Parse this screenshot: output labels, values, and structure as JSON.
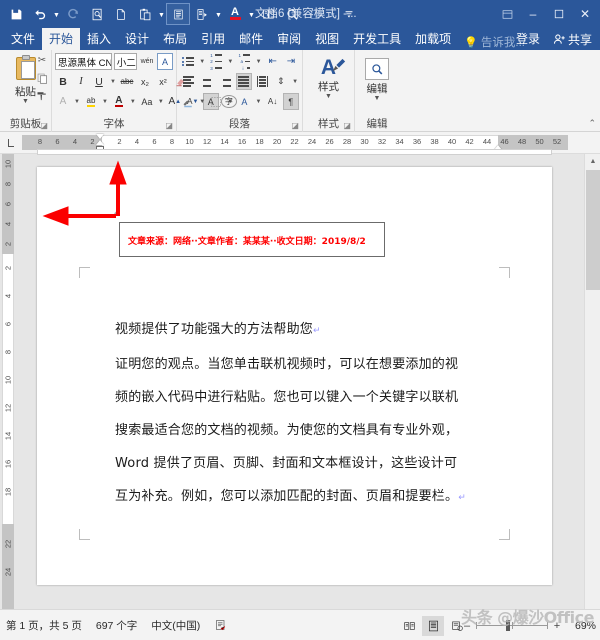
{
  "titlebar": {
    "document_title": "文档6 [兼容模式] -...",
    "quick_access": [
      {
        "name": "save-icon",
        "glyph": "Ὃe"
      },
      {
        "name": "undo-icon",
        "glyph": "↶"
      },
      {
        "name": "redo-icon",
        "glyph": "↻"
      },
      {
        "name": "print-preview-icon",
        "glyph": "ὐd"
      },
      {
        "name": "new-document-icon",
        "glyph": "὜b"
      },
      {
        "name": "paste-icon",
        "glyph": "Ὄb"
      },
      {
        "name": "document-view-icon",
        "glyph": "☰"
      },
      {
        "name": "paragraph-mark-icon",
        "glyph": "¶"
      },
      {
        "name": "font-color-icon",
        "glyph": "A"
      },
      {
        "name": "two-page-icon",
        "glyph": "Ὅ6"
      },
      {
        "name": "find-icon",
        "glyph": "ὐe"
      },
      {
        "name": "edit-icon",
        "glyph": "✎"
      },
      {
        "name": "customize-qat-icon",
        "glyph": "≡"
      }
    ],
    "window_controls": {
      "ribbon_display": "⬚",
      "minimize": "–",
      "maximize": "□",
      "close": "✕"
    }
  },
  "tabs": [
    {
      "label": "文件",
      "active": false,
      "style": "file"
    },
    {
      "label": "开始",
      "active": true,
      "style": "normal"
    },
    {
      "label": "插入",
      "active": false,
      "style": "normal"
    },
    {
      "label": "设计",
      "active": false,
      "style": "normal"
    },
    {
      "label": "布局",
      "active": false,
      "style": "normal"
    },
    {
      "label": "引用",
      "active": false,
      "style": "normal"
    },
    {
      "label": "邮件",
      "active": false,
      "style": "normal"
    },
    {
      "label": "审阅",
      "active": false,
      "style": "normal"
    },
    {
      "label": "视图",
      "active": false,
      "style": "normal"
    },
    {
      "label": "开发工具",
      "active": false,
      "style": "normal"
    },
    {
      "label": "加载项",
      "active": false,
      "style": "normal"
    }
  ],
  "tellme": {
    "placeholder": "告诉我..."
  },
  "account": {
    "signin_label": "登录",
    "share_label": "共享"
  },
  "ribbon": {
    "clipboard": {
      "group_title": "剪贴板",
      "paste_label": "粘贴",
      "cut_title": "剪切",
      "copy_title": "复制",
      "format_painter_title": "格式刷"
    },
    "font": {
      "group_title": "字体",
      "font_name": "思源黑体 CN Light (中文",
      "font_size": "小二",
      "bold": "B",
      "italic": "I",
      "underline": "U",
      "strikethrough": "abc",
      "subscript": "x₂",
      "superscript": "x²",
      "clear_format": "⌫",
      "text_effects": "A",
      "highlight": "ab",
      "font_color": "A",
      "change_case": "Aa",
      "grow_font": "A",
      "shrink_font": "A",
      "char_shading": "A",
      "char_border": "字",
      "phonetic_guide": "wén"
    },
    "paragraph": {
      "group_title": "段落",
      "bullets": "bullet-list",
      "numbering": "numbered-list",
      "multilevel": "multilevel-list",
      "decrease_indent": "decrease-indent",
      "increase_indent": "increase-indent",
      "align_left": "align-left",
      "align_center": "align-center",
      "align_right": "align-right",
      "justify": "justify",
      "distribute": "distribute",
      "line_spacing": "line-spacing",
      "shading": "shading",
      "borders": "borders",
      "pinyin": "pinyin",
      "sort": "sort",
      "show_marks": "show-paragraph-marks"
    },
    "styles": {
      "group_title": "样式",
      "label": "样式"
    },
    "editing": {
      "group_title": "编辑",
      "label": "编辑"
    }
  },
  "ruler": {
    "tab_selector": "left-tab",
    "horizontal_left_numbers": [
      "8",
      "6",
      "4",
      "2"
    ],
    "horizontal_numbers": [
      "2",
      "4",
      "6",
      "8",
      "10",
      "12",
      "14",
      "16",
      "18",
      "20",
      "22",
      "24",
      "26",
      "28",
      "30",
      "32",
      "34",
      "36",
      "38",
      "40",
      "42",
      "44",
      "46",
      "48",
      "50",
      "52"
    ],
    "vertical_top_numbers": [
      "10",
      "8",
      "6",
      "4",
      "2"
    ],
    "vertical_numbers": [
      "2",
      "4",
      "6",
      "8",
      "10",
      "12",
      "14",
      "16",
      "18"
    ],
    "vertical_bottom_numbers": [
      "22",
      "24"
    ]
  },
  "document": {
    "textbox_text": "文章来源：网络··文章作者：某某某··收文日期：2019/8/2",
    "textbox_color": "#ff0000",
    "body_lines": [
      "视频提供了功能强大的方法帮助您",
      "证明您的观点。当您单击联机视频时，可以在想要添加的视",
      "频的嵌入代码中进行粘贴。您也可以键入一个关键字以联机",
      "搜索最适合您的文档的视频。为使您的文档具有专业外观，",
      "Word 提供了页眉、页脚、封面和文本框设计，这些设计可",
      "互为补充。例如，您可以添加匹配的封面、页眉和提要栏。"
    ],
    "annotation": {
      "arrow_color": "#ff0000",
      "arrows": [
        "up-arrow",
        "left-arrow"
      ]
    }
  },
  "statusbar": {
    "page_info": "第 1 页，共 5 页",
    "word_count": "697 个字",
    "language": "中文(中国)",
    "proofing_icon": "proofing-errors-icon",
    "views": [
      {
        "name": "read-mode-view",
        "active": false
      },
      {
        "name": "print-layout-view",
        "active": true
      },
      {
        "name": "web-layout-view",
        "active": false
      }
    ],
    "zoom_out": "–",
    "zoom_in": "+",
    "zoom_value": "69%"
  },
  "watermark": {
    "text": "头条 @爆沙Office"
  }
}
